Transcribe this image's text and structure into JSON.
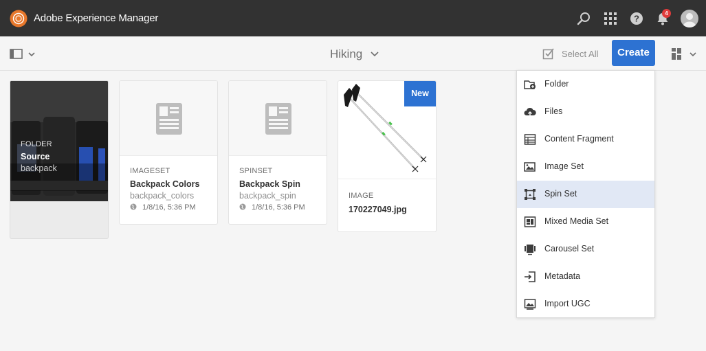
{
  "header": {
    "app_title": "Adobe Experience Manager",
    "notification_count": "4",
    "icons": [
      "aem-logo-icon",
      "search-icon",
      "apps-grid-icon",
      "help-icon",
      "bell-icon",
      "user-avatar"
    ]
  },
  "actionbar": {
    "title": "Hiking",
    "select_all": "Select All",
    "create": "Create",
    "icons": [
      "rail-toggle-icon",
      "chevron-down-icon",
      "checkbox-icon",
      "view-switcher-icon"
    ]
  },
  "cards": [
    {
      "type": "FOLDER",
      "title": "Source",
      "name": "backpack"
    },
    {
      "type": "IMAGESET",
      "title": "Backpack Colors",
      "name": "backpack_colors",
      "date": "1/8/16, 5:36 PM"
    },
    {
      "type": "SPINSET",
      "title": "Backpack Spin",
      "name": "backpack_spin",
      "date": "1/8/16, 5:36 PM"
    },
    {
      "type": "IMAGE",
      "title": "170227049.jpg",
      "badge": "New"
    }
  ],
  "create_menu": {
    "items": [
      {
        "label": "Folder",
        "icon": "folder-add-icon"
      },
      {
        "label": "Files",
        "icon": "upload-cloud-icon"
      },
      {
        "label": "Content Fragment",
        "icon": "content-fragment-icon"
      },
      {
        "label": "Image Set",
        "icon": "image-set-icon"
      },
      {
        "label": "Spin Set",
        "icon": "spin-set-icon",
        "selected": true
      },
      {
        "label": "Mixed Media Set",
        "icon": "mixed-media-set-icon"
      },
      {
        "label": "Carousel Set",
        "icon": "carousel-set-icon"
      },
      {
        "label": "Metadata",
        "icon": "metadata-import-icon"
      },
      {
        "label": "Import UGC",
        "icon": "import-ugc-icon"
      }
    ]
  },
  "colors": {
    "header_bg": "#323232",
    "accent": "#2d72d2",
    "selected_item": "#e1e8f5",
    "notification": "#e03c3c"
  }
}
